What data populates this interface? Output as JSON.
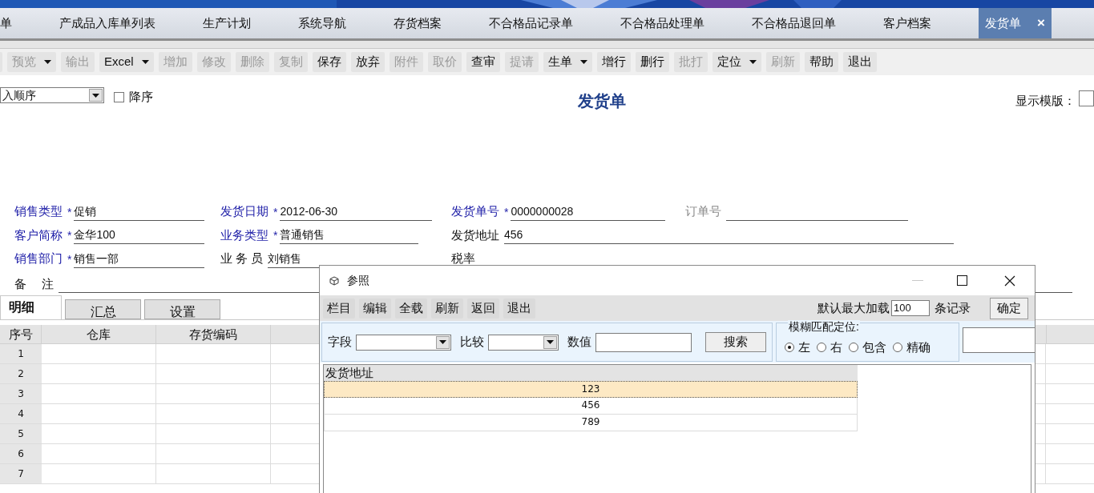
{
  "tabs": [
    {
      "label": "单",
      "selected": false
    },
    {
      "label": "产成品入库单列表",
      "selected": false
    },
    {
      "label": "生产计划",
      "selected": false
    },
    {
      "label": "系统导航",
      "selected": false
    },
    {
      "label": "存货档案",
      "selected": false
    },
    {
      "label": "不合格品记录单",
      "selected": false
    },
    {
      "label": "不合格品处理单",
      "selected": false
    },
    {
      "label": "不合格品退回单",
      "selected": false
    },
    {
      "label": "客户档案",
      "selected": false
    },
    {
      "label": "发货单",
      "selected": true,
      "close": "×"
    }
  ],
  "toolbar": [
    {
      "kind": "dropdown"
    },
    {
      "label": "预览",
      "kind": "dropdown",
      "disabled": true
    },
    {
      "label": "输出",
      "kind": "button",
      "disabled": true
    },
    {
      "label": "Excel",
      "kind": "dropdown",
      "disabled": false
    },
    {
      "label": "增加",
      "kind": "button",
      "disabled": true
    },
    {
      "label": "修改",
      "kind": "button",
      "disabled": true
    },
    {
      "label": "删除",
      "kind": "button",
      "disabled": true
    },
    {
      "label": "复制",
      "kind": "button",
      "disabled": true
    },
    {
      "label": "保存",
      "kind": "button",
      "disabled": false
    },
    {
      "label": "放弃",
      "kind": "button",
      "disabled": false
    },
    {
      "label": "附件",
      "kind": "button",
      "disabled": true
    },
    {
      "label": "取价",
      "kind": "button",
      "disabled": true
    },
    {
      "label": "查审",
      "kind": "button",
      "disabled": false
    },
    {
      "label": "提请",
      "kind": "button",
      "disabled": true
    },
    {
      "label": "生单",
      "kind": "dropdown",
      "disabled": false
    },
    {
      "label": "增行",
      "kind": "button",
      "disabled": false
    },
    {
      "label": "删行",
      "kind": "button",
      "disabled": false
    },
    {
      "label": "批打",
      "kind": "button",
      "disabled": true
    },
    {
      "label": "定位",
      "kind": "dropdown",
      "disabled": false
    },
    {
      "label": "刷新",
      "kind": "button",
      "disabled": true
    },
    {
      "label": "帮助",
      "kind": "button",
      "disabled": false
    },
    {
      "label": "退出",
      "kind": "button",
      "disabled": false
    }
  ],
  "sort": {
    "value": "入顺序",
    "descending": {
      "label": "降序",
      "checked": false
    }
  },
  "title": "发货单",
  "template": {
    "label": "显示模版："
  },
  "form_rows": [
    [
      {
        "label": "销售类型",
        "kind": "required",
        "value": "促销"
      },
      {
        "label": "发货日期",
        "kind": "required",
        "value": "2012-06-30"
      },
      {
        "label": "发货单号",
        "kind": "required",
        "value": "0000000028"
      },
      {
        "label": "订单号",
        "kind": "readonly"
      }
    ],
    [
      {
        "label": "客户简称",
        "kind": "required",
        "value": "金华100"
      },
      {
        "label": "业务类型",
        "kind": "required",
        "value": "普通销售"
      },
      {
        "label": "发货地址",
        "kind": "plain",
        "value": "456"
      }
    ],
    [
      {
        "label": "销售部门",
        "kind": "required",
        "value": "销售一部"
      },
      {
        "label": "业 务 员",
        "kind": "plain",
        "value": "刘销售"
      },
      {
        "label": "税率",
        "kind": "plain"
      }
    ],
    [
      {
        "label": "备　 注",
        "kind": "plain"
      }
    ]
  ],
  "required_mark": "*",
  "detail_tabs": [
    {
      "label": "明细",
      "selected": true
    },
    {
      "label": "汇总",
      "selected": false
    },
    {
      "label": "设置",
      "selected": false
    }
  ],
  "table": {
    "columns": [
      "序号",
      "仓库",
      "存货编码"
    ],
    "rows": [
      "1",
      "2",
      "3",
      "4",
      "5",
      "6",
      "7"
    ]
  },
  "dialog": {
    "title": "参照",
    "toolbar": [
      "栏目",
      "编辑",
      "全载",
      "刷新",
      "返回",
      "退出"
    ],
    "max_load": {
      "label": "默认最大加载",
      "value": "100",
      "unit": "条记录"
    },
    "ok": "确定",
    "search": {
      "field_label": "字段",
      "compare_label": "比较",
      "value_label": "数值",
      "button": "搜索"
    },
    "fuzzy": {
      "legend": "模糊匹配定位:",
      "options": [
        {
          "label": "左",
          "selected": true
        },
        {
          "label": "右",
          "selected": false
        },
        {
          "label": "包含",
          "selected": false
        },
        {
          "label": "精确",
          "selected": false
        }
      ]
    },
    "grid": {
      "columns": [
        "发货地址"
      ],
      "rows": [
        {
          "cells": [
            "123"
          ],
          "selected": true
        },
        {
          "cells": [
            "456"
          ],
          "selected": false
        },
        {
          "cells": [
            "789"
          ],
          "selected": false
        }
      ]
    }
  }
}
